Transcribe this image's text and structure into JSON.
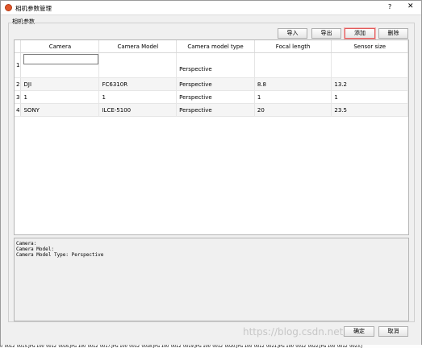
{
  "window": {
    "title": "相机参数管理",
    "help_label": "?",
    "close_label": "✕"
  },
  "group": {
    "title": "相机参数"
  },
  "toolbar": {
    "import_label": "导入",
    "export_label": "导出",
    "add_label": "添加",
    "delete_label": "删除"
  },
  "table": {
    "columns": [
      "Camera",
      "Camera Model",
      "Camera model type",
      "Focal length",
      "Sensor size"
    ],
    "rows": [
      {
        "num": "1",
        "camera": "",
        "model": "",
        "type": "Perspective",
        "focal": "",
        "sensor": ""
      },
      {
        "num": "2",
        "camera": "DJI",
        "model": "FC6310R",
        "type": "Perspective",
        "focal": "8.8",
        "sensor": "13.2"
      },
      {
        "num": "3",
        "camera": "1",
        "model": "1",
        "type": "Perspective",
        "focal": "1",
        "sensor": "1"
      },
      {
        "num": "4",
        "camera": "SONY",
        "model": "ILCE-5100",
        "type": "Perspective",
        "focal": "20",
        "sensor": "23.5"
      }
    ]
  },
  "info": {
    "line1": "Camera:",
    "line2": "Camera Model:",
    "line3": "Camera Model Type: Perspective"
  },
  "footer": {
    "ok_label": "确定",
    "cancel_label": "取消",
    "watermark": "https://blog.csdn.net/...",
    "filmstrip": "0_0012_0015.JPG 100_0012_0016.JPG 100_0012_0017.JPG 100_0012_0018.JPG 100_0012_0019.JPG 100_0012_0020.JPG 100_0012_0021.JPG 100_0012_0022.JPG 100_0012_0023.J"
  }
}
